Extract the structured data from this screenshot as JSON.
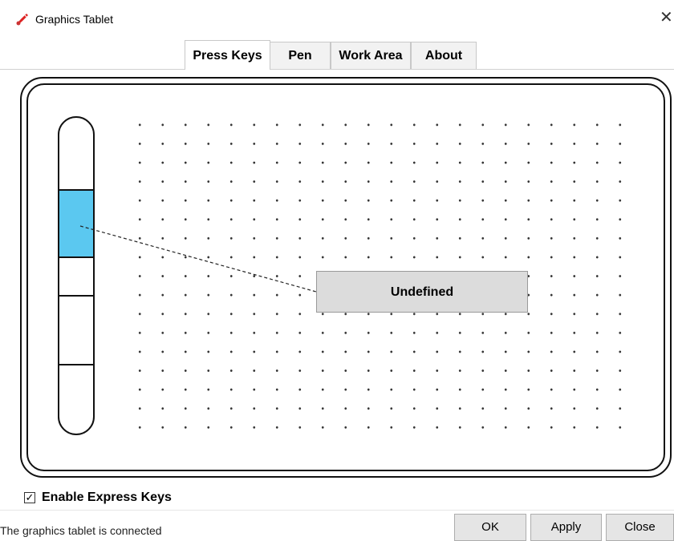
{
  "window": {
    "title": "Graphics Tablet",
    "icon": "paint-brush-icon",
    "close_glyph": "✕"
  },
  "tabs": [
    {
      "label": "Press Keys",
      "active": true
    },
    {
      "label": "Pen",
      "active": false
    },
    {
      "label": "Work Area",
      "active": false
    },
    {
      "label": "About",
      "active": false
    }
  ],
  "express_keys": {
    "count": 5,
    "selected_index": 1,
    "selected_function": "Undefined",
    "highlight_color": "#5bc8f0"
  },
  "enable_express_keys": {
    "checked": true,
    "check_glyph": "✓",
    "label": "Enable Express Keys"
  },
  "status": "The graphics tablet is connected",
  "buttons": {
    "ok": "OK",
    "apply": "Apply",
    "close": "Close"
  }
}
